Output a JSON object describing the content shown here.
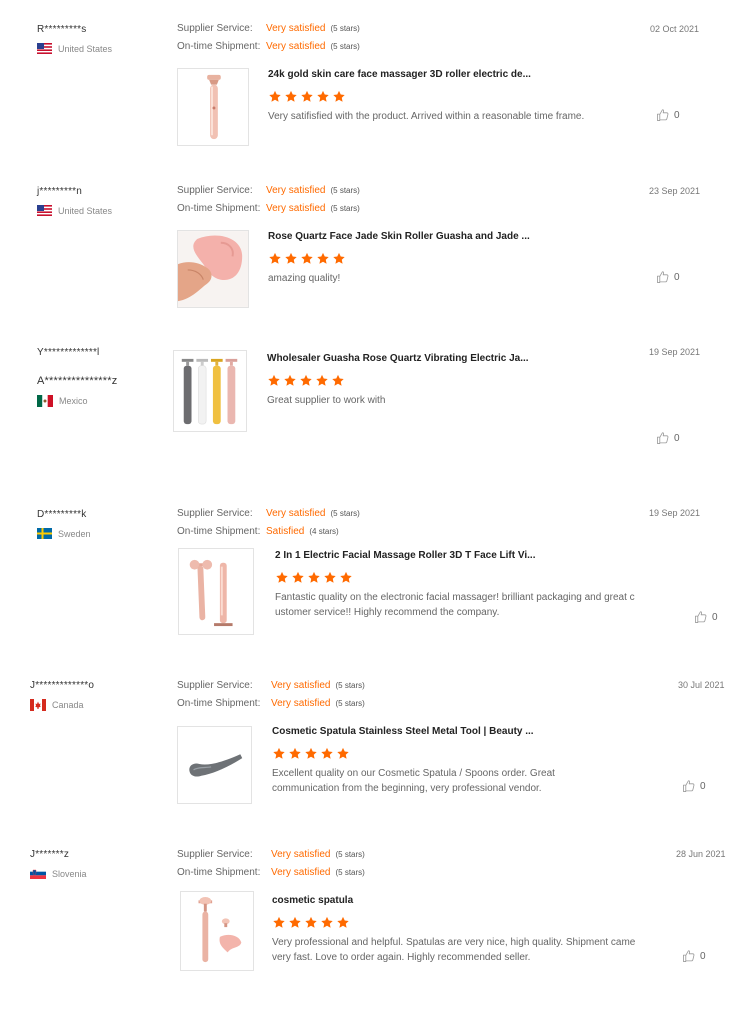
{
  "labels": {
    "supplier_service": "Supplier Service:",
    "ontime_shipment": "On-time Shipment:"
  },
  "colors": {
    "accent": "#ff6a00"
  },
  "reviews": [
    {
      "name": "R*********s",
      "country": "United States",
      "flag": "us-flag",
      "date": "02 Oct 2021",
      "supplier_value": "Very satisfied",
      "supplier_stars": "(5 stars)",
      "shipment_value": "Very satisfied",
      "shipment_stars": "(5 stars)",
      "product": "24k gold skin care face massager 3D roller electric de...",
      "rating": 5,
      "text": "Very satifisfied with the product. Arrived within a reasonable time frame.",
      "likes": "0"
    },
    {
      "name": "j*********n",
      "country": "United States",
      "flag": "us-flag",
      "date": "23 Sep 2021",
      "supplier_value": "Very satisfied",
      "supplier_stars": "(5 stars)",
      "shipment_value": "Very satisfied",
      "shipment_stars": "(5 stars)",
      "product": "Rose Quartz Face Jade Skin Roller Guasha and Jade ...",
      "rating": 5,
      "text": "amazing quality!",
      "likes": "0"
    },
    {
      "name": "Y*************l",
      "name2": "A***************z",
      "country": "Mexico",
      "flag": "mexico-flag",
      "date": "19 Sep 2021",
      "product": "Wholesaler Guasha Rose Quartz Vibrating Electric Ja...",
      "rating": 5,
      "text": "Great supplier to work with",
      "likes": "0"
    },
    {
      "name": "D*********k",
      "country": "Sweden",
      "flag": "sweden-flag",
      "date": "19 Sep 2021",
      "supplier_value": "Very satisfied",
      "supplier_stars": "(5 stars)",
      "shipment_value": "Satisfied",
      "shipment_stars": "(4 stars)",
      "product": "2 In 1 Electric Facial Massage Roller 3D T Face Lift Vi...",
      "rating": 5,
      "text": "Fantastic quality on the electronic facial massager! brilliant packaging and great c ustomer service!! Highly recommend the company.",
      "likes": "0"
    },
    {
      "name": "J*************o",
      "country": "Canada",
      "flag": "canada-flag",
      "date": "30 Jul 2021",
      "supplier_value": "Very satisfied",
      "supplier_stars": "(5 stars)",
      "shipment_value": "Very satisfied",
      "shipment_stars": "(5 stars)",
      "product": "Cosmetic Spatula Stainless Steel Metal Tool | Beauty ...",
      "rating": 5,
      "text": "Excellent quality on our Cosmetic Spatula / Spoons order. Great communication from the beginning, very professional vendor.",
      "likes": "0"
    },
    {
      "name": "J*******z",
      "country": "Slovenia",
      "flag": "slovenia-flag",
      "date": "28 Jun 2021",
      "supplier_value": "Very satisfied",
      "supplier_stars": "(5 stars)",
      "shipment_value": "Very satisfied",
      "shipment_stars": "(5 stars)",
      "product": "cosmetic spatula",
      "rating": 5,
      "text": "Very professional and helpful. Spatulas are very nice, high quality. Shipment came very fast. Love to order again. Highly recommended seller.",
      "likes": "0"
    }
  ]
}
